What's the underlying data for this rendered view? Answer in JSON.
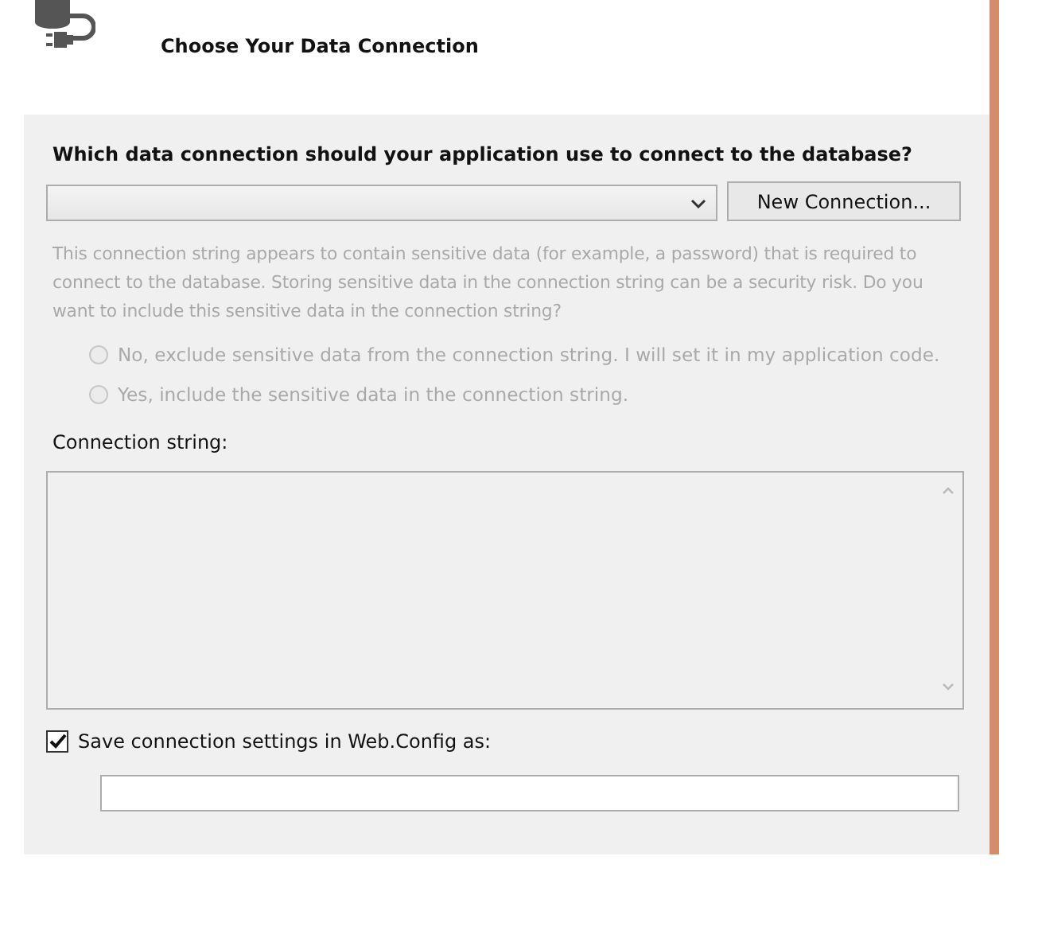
{
  "header": {
    "title": "Choose Your Data Connection"
  },
  "question": "Which data connection should your application use to connect to the database?",
  "connection_dropdown": {
    "disabled": false
  },
  "new_connection_button": "New Connection...",
  "sensitive_notice": {
    "text": "This connection string appears to contain sensitive data (for example, a password) that is required to connect to the database. Storing sensitive data in the connection string can be a security risk. Do you want to include this sensitive data in the connection string?",
    "disabled": true
  },
  "sensitive_options": [
    {
      "label": "No, exclude sensitive data from the connection string. I will set it in my application code.",
      "selected": false,
      "disabled": true
    },
    {
      "label": "Yes, include the sensitive data in the connection string.",
      "selected": false,
      "disabled": true
    }
  ],
  "connection_string": {
    "label": "Connection string:",
    "disabled": true
  },
  "save_setting": {
    "label": "Save connection settings in Web.Config as:",
    "checked": true
  }
}
